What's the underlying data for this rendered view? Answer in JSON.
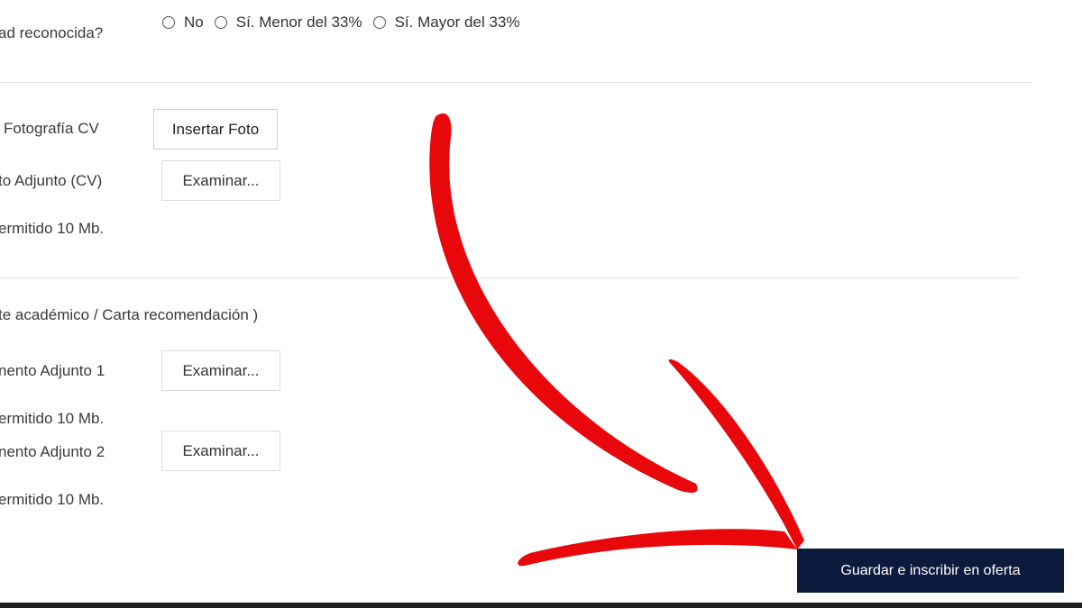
{
  "disability": {
    "question": "ad reconocida?",
    "options": [
      "No",
      "Sí. Menor del 33%",
      "Sí. Mayor del 33%"
    ]
  },
  "photo": {
    "label": "Fotografía CV",
    "button": "Insertar Foto"
  },
  "cv_attachment": {
    "label": "to Adjunto (CV)",
    "button": "Examinar...",
    "limit": "ermitido 10 Mb."
  },
  "extra_section": {
    "title": "te académico / Carta recomendación )"
  },
  "doc1": {
    "label": "nento Adjunto 1",
    "button": "Examinar...",
    "limit": "ermitido 10 Mb."
  },
  "doc2": {
    "label": "nento Adjunto 2",
    "button": "Examinar...",
    "limit": "ermitido 10 Mb."
  },
  "submit": {
    "label": "Guardar e inscribir en oferta"
  },
  "colors": {
    "primary_button": "#0b1a3d",
    "annotation_arrow": "#e8070b"
  }
}
